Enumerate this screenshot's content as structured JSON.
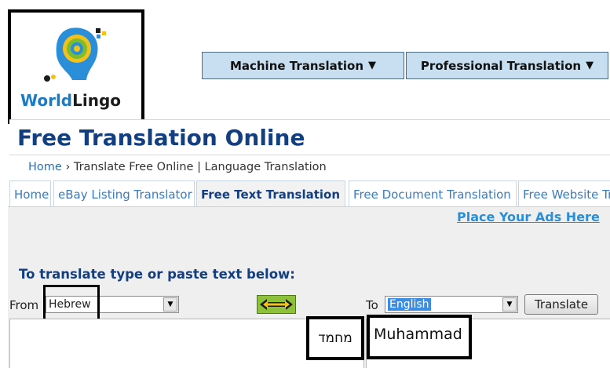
{
  "logo": {
    "world": "World",
    "lingo": "Lingo"
  },
  "nav": {
    "machine_translation": "Machine Translation",
    "professional_translation": "Professional Translation",
    "caret": "▼"
  },
  "page_title": "Free Translation Online",
  "breadcrumb": {
    "home": "Home",
    "separator": "›",
    "current": "Translate Free Online | Language Translation"
  },
  "tabs": [
    {
      "label": "Home",
      "active": false
    },
    {
      "label": "eBay Listing Translator",
      "active": false
    },
    {
      "label": "Free Text Translation",
      "active": true
    },
    {
      "label": "Free Document Translation",
      "active": false
    },
    {
      "label": "Free Website Translation",
      "active": false
    }
  ],
  "ads_link": "Place Your Ads Here",
  "instruction": "To translate type or paste text below:",
  "form": {
    "from_label": "From",
    "from_value": "Hebrew",
    "to_label": "To",
    "to_value": "English",
    "translate_button": "Translate",
    "source_text": "מחמד",
    "translated_text": "Muhammad"
  },
  "icons": {
    "swap": "swap-arrows-icon",
    "dropdown": "chevron-down-icon"
  },
  "colors": {
    "title_blue": "#133e80",
    "link_blue": "#2a6fb5",
    "nav_bg": "#c7dff0",
    "swap_green": "#8ec13a",
    "logo_blue": "#1a7cc2"
  }
}
